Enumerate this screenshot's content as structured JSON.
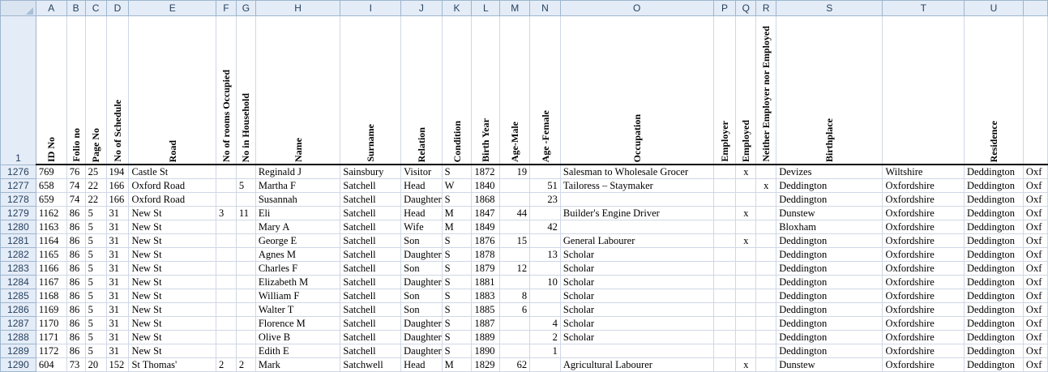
{
  "columns": [
    "A",
    "B",
    "C",
    "D",
    "E",
    "F",
    "G",
    "H",
    "I",
    "J",
    "K",
    "L",
    "M",
    "N",
    "O",
    "P",
    "Q",
    "R",
    "S",
    "T",
    "U",
    ""
  ],
  "header_row_number": "1",
  "headers": [
    "ID No",
    "Folio no",
    "Page No",
    "No of Schedule",
    "Road",
    "No of rooms Occupied",
    "No in Household",
    "Name",
    "Surname",
    "Relation",
    "Condition",
    "Birth Year",
    "Age-Male",
    "Age -Female",
    "Occupation",
    "Employer",
    "Employed",
    "Neither Employer nor Employed",
    "Birthplace",
    "",
    "Residence",
    ""
  ],
  "rows": [
    {
      "rownum": "1276",
      "cells": [
        "769",
        "76",
        "25",
        "194",
        "Castle St",
        "",
        "",
        "Reginald J",
        "Sainsbury",
        "Visitor",
        "S",
        "1872",
        "19",
        "",
        "Salesman to Wholesale Grocer",
        "",
        "x",
        "",
        "Devizes",
        "Wiltshire",
        "Deddington",
        "Oxf"
      ]
    },
    {
      "rownum": "1277",
      "cells": [
        "658",
        "74",
        "22",
        "166",
        "Oxford Road",
        "",
        "5",
        "Martha F",
        "Satchell",
        "Head",
        "W",
        "1840",
        "",
        "51",
        "Tailoress – Staymaker",
        "",
        "",
        "x",
        "Deddington",
        "Oxfordshire",
        "Deddington",
        "Oxf"
      ]
    },
    {
      "rownum": "1278",
      "cells": [
        "659",
        "74",
        "22",
        "166",
        "Oxford Road",
        "",
        "",
        "Susannah",
        "Satchell",
        "Daughter",
        "S",
        "1868",
        "",
        "23",
        "",
        "",
        "",
        "",
        "Deddington",
        "Oxfordshire",
        "Deddington",
        "Oxf"
      ]
    },
    {
      "rownum": "1279",
      "cells": [
        "1162",
        "86",
        "5",
        "31",
        "New St",
        "3",
        "11",
        "Eli",
        "Satchell",
        "Head",
        "M",
        "1847",
        "44",
        "",
        "Builder's Engine Driver",
        "",
        "x",
        "",
        "Dunstew",
        "Oxfordshire",
        "Deddington",
        "Oxf"
      ]
    },
    {
      "rownum": "1280",
      "cells": [
        "1163",
        "86",
        "5",
        "31",
        "New St",
        "",
        "",
        "Mary A",
        "Satchell",
        "Wife",
        "M",
        "1849",
        "",
        "42",
        "",
        "",
        "",
        "",
        "Bloxham",
        "Oxfordshire",
        "Deddington",
        "Oxf"
      ]
    },
    {
      "rownum": "1281",
      "cells": [
        "1164",
        "86",
        "5",
        "31",
        "New St",
        "",
        "",
        "George E",
        "Satchell",
        "Son",
        "S",
        "1876",
        "15",
        "",
        "General Labourer",
        "",
        "x",
        "",
        "Deddington",
        "Oxfordshire",
        "Deddington",
        "Oxf"
      ]
    },
    {
      "rownum": "1282",
      "cells": [
        "1165",
        "86",
        "5",
        "31",
        "New St",
        "",
        "",
        "Agnes M",
        "Satchell",
        "Daughter",
        "S",
        "1878",
        "",
        "13",
        "Scholar",
        "",
        "",
        "",
        "Deddington",
        "Oxfordshire",
        "Deddington",
        "Oxf"
      ]
    },
    {
      "rownum": "1283",
      "cells": [
        "1166",
        "86",
        "5",
        "31",
        "New St",
        "",
        "",
        "Charles F",
        "Satchell",
        "Son",
        "S",
        "1879",
        "12",
        "",
        "Scholar",
        "",
        "",
        "",
        "Deddington",
        "Oxfordshire",
        "Deddington",
        "Oxf"
      ]
    },
    {
      "rownum": "1284",
      "cells": [
        "1167",
        "86",
        "5",
        "31",
        "New St",
        "",
        "",
        "Elizabeth M",
        "Satchell",
        "Daughter",
        "S",
        "1881",
        "",
        "10",
        "Scholar",
        "",
        "",
        "",
        "Deddington",
        "Oxfordshire",
        "Deddington",
        "Oxf"
      ]
    },
    {
      "rownum": "1285",
      "cells": [
        "1168",
        "86",
        "5",
        "31",
        "New St",
        "",
        "",
        "William F",
        "Satchell",
        "Son",
        "S",
        "1883",
        "8",
        "",
        "Scholar",
        "",
        "",
        "",
        "Deddington",
        "Oxfordshire",
        "Deddington",
        "Oxf"
      ]
    },
    {
      "rownum": "1286",
      "cells": [
        "1169",
        "86",
        "5",
        "31",
        "New St",
        "",
        "",
        "Walter T",
        "Satchell",
        "Son",
        "S",
        "1885",
        "6",
        "",
        "Scholar",
        "",
        "",
        "",
        "Deddington",
        "Oxfordshire",
        "Deddington",
        "Oxf"
      ]
    },
    {
      "rownum": "1287",
      "cells": [
        "1170",
        "86",
        "5",
        "31",
        "New St",
        "",
        "",
        "Florence M",
        "Satchell",
        "Daughter",
        "S",
        "1887",
        "",
        "4",
        "Scholar",
        "",
        "",
        "",
        "Deddington",
        "Oxfordshire",
        "Deddington",
        "Oxf"
      ]
    },
    {
      "rownum": "1288",
      "cells": [
        "1171",
        "86",
        "5",
        "31",
        "New St",
        "",
        "",
        "Olive B",
        "Satchell",
        "Daughter",
        "S",
        "1889",
        "",
        "2",
        "Scholar",
        "",
        "",
        "",
        "Deddington",
        "Oxfordshire",
        "Deddington",
        "Oxf"
      ]
    },
    {
      "rownum": "1289",
      "cells": [
        "1172",
        "86",
        "5",
        "31",
        "New St",
        "",
        "",
        "Edith E",
        "Satchell",
        "Daughter",
        "S",
        "1890",
        "",
        "1",
        "",
        "",
        "",
        "",
        "Deddington",
        "Oxfordshire",
        "Deddington",
        "Oxf"
      ]
    },
    {
      "rownum": "1290",
      "cells": [
        "604",
        "73",
        "20",
        "152",
        "St Thomas'",
        "2",
        "2",
        "Mark",
        "Satchwell",
        "Head",
        "M",
        "1829",
        "62",
        "",
        "Agricultural Labourer",
        "",
        "x",
        "",
        "Dunstew",
        "Oxfordshire",
        "Deddington",
        "Oxf"
      ]
    }
  ]
}
